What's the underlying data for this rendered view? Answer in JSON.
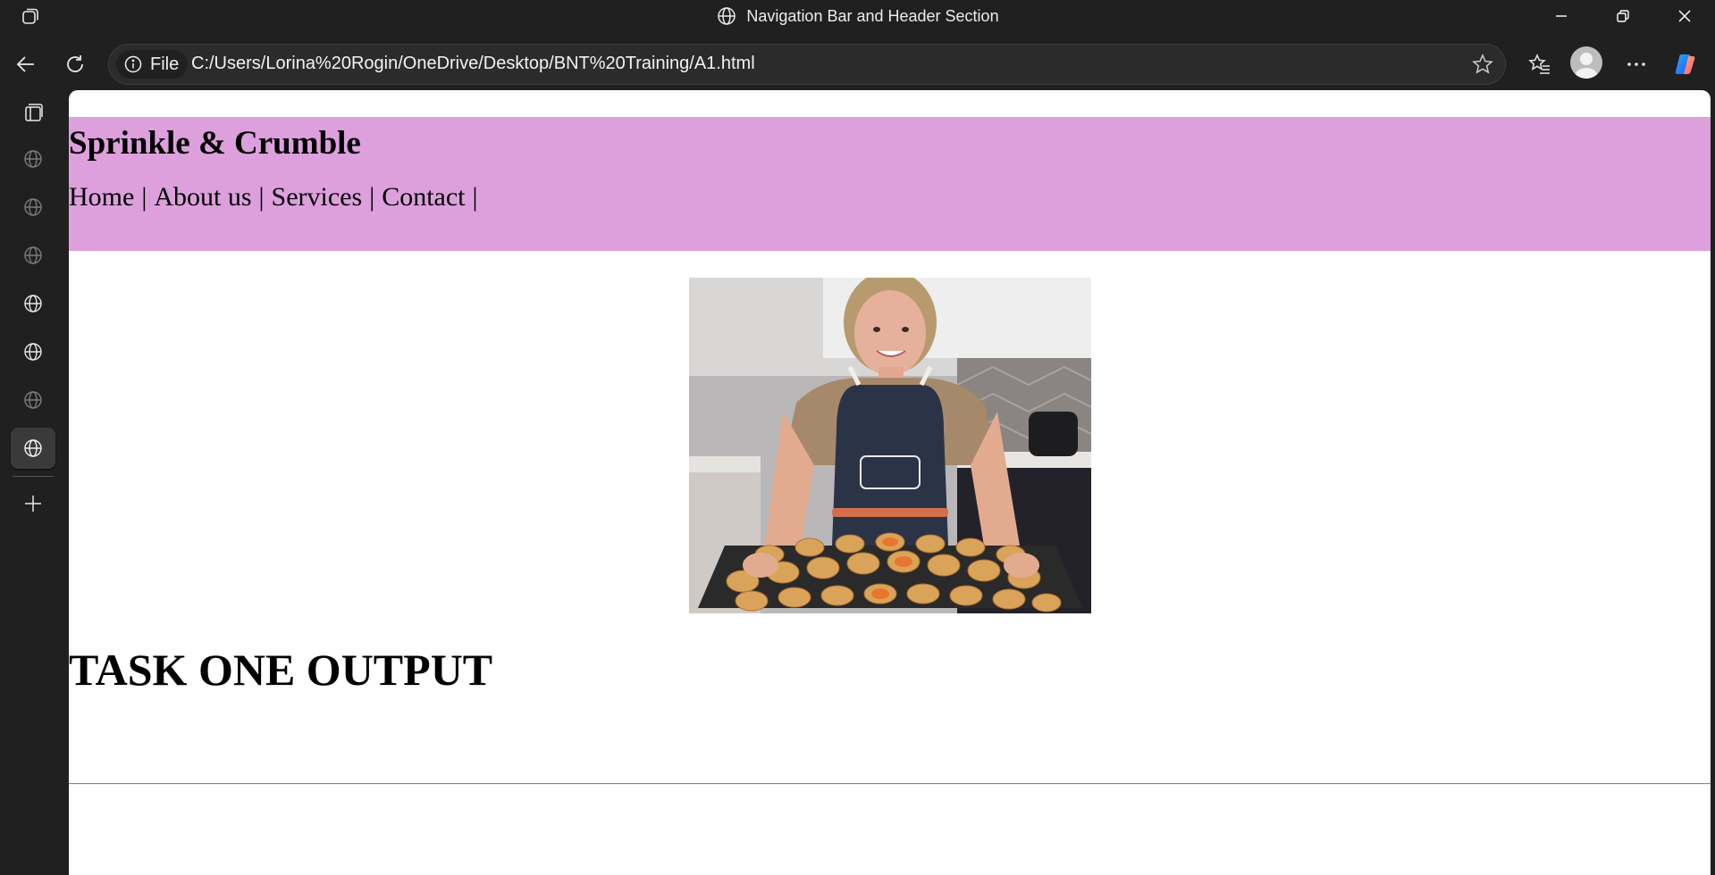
{
  "window": {
    "title": "Navigation Bar and Header Section"
  },
  "address_bar": {
    "scheme_label": "File",
    "url": "C:/Users/Lorina%20Rogin/OneDrive/Desktop/BNT%20Training/A1.html"
  },
  "page": {
    "brand": "Sprinkle & Crumble",
    "nav_items": [
      {
        "label": "Home"
      },
      {
        "label": "About us"
      },
      {
        "label": "Services"
      },
      {
        "label": "Contact"
      }
    ],
    "nav_separator": "|",
    "heading": "TASK ONE OUTPUT",
    "header_color": "#dda0dd"
  },
  "icons": {
    "sidebar": [
      "tab-actions-icon",
      "globe-icon",
      "globe-icon",
      "globe-icon",
      "globe-icon",
      "globe-icon",
      "globe-icon",
      "globe-icon",
      "add-icon"
    ],
    "toolbar": [
      "back-icon",
      "refresh-icon",
      "info-icon",
      "favorite-star-icon",
      "favorites-icon",
      "profile-icon",
      "more-icon",
      "copilot-icon"
    ]
  }
}
